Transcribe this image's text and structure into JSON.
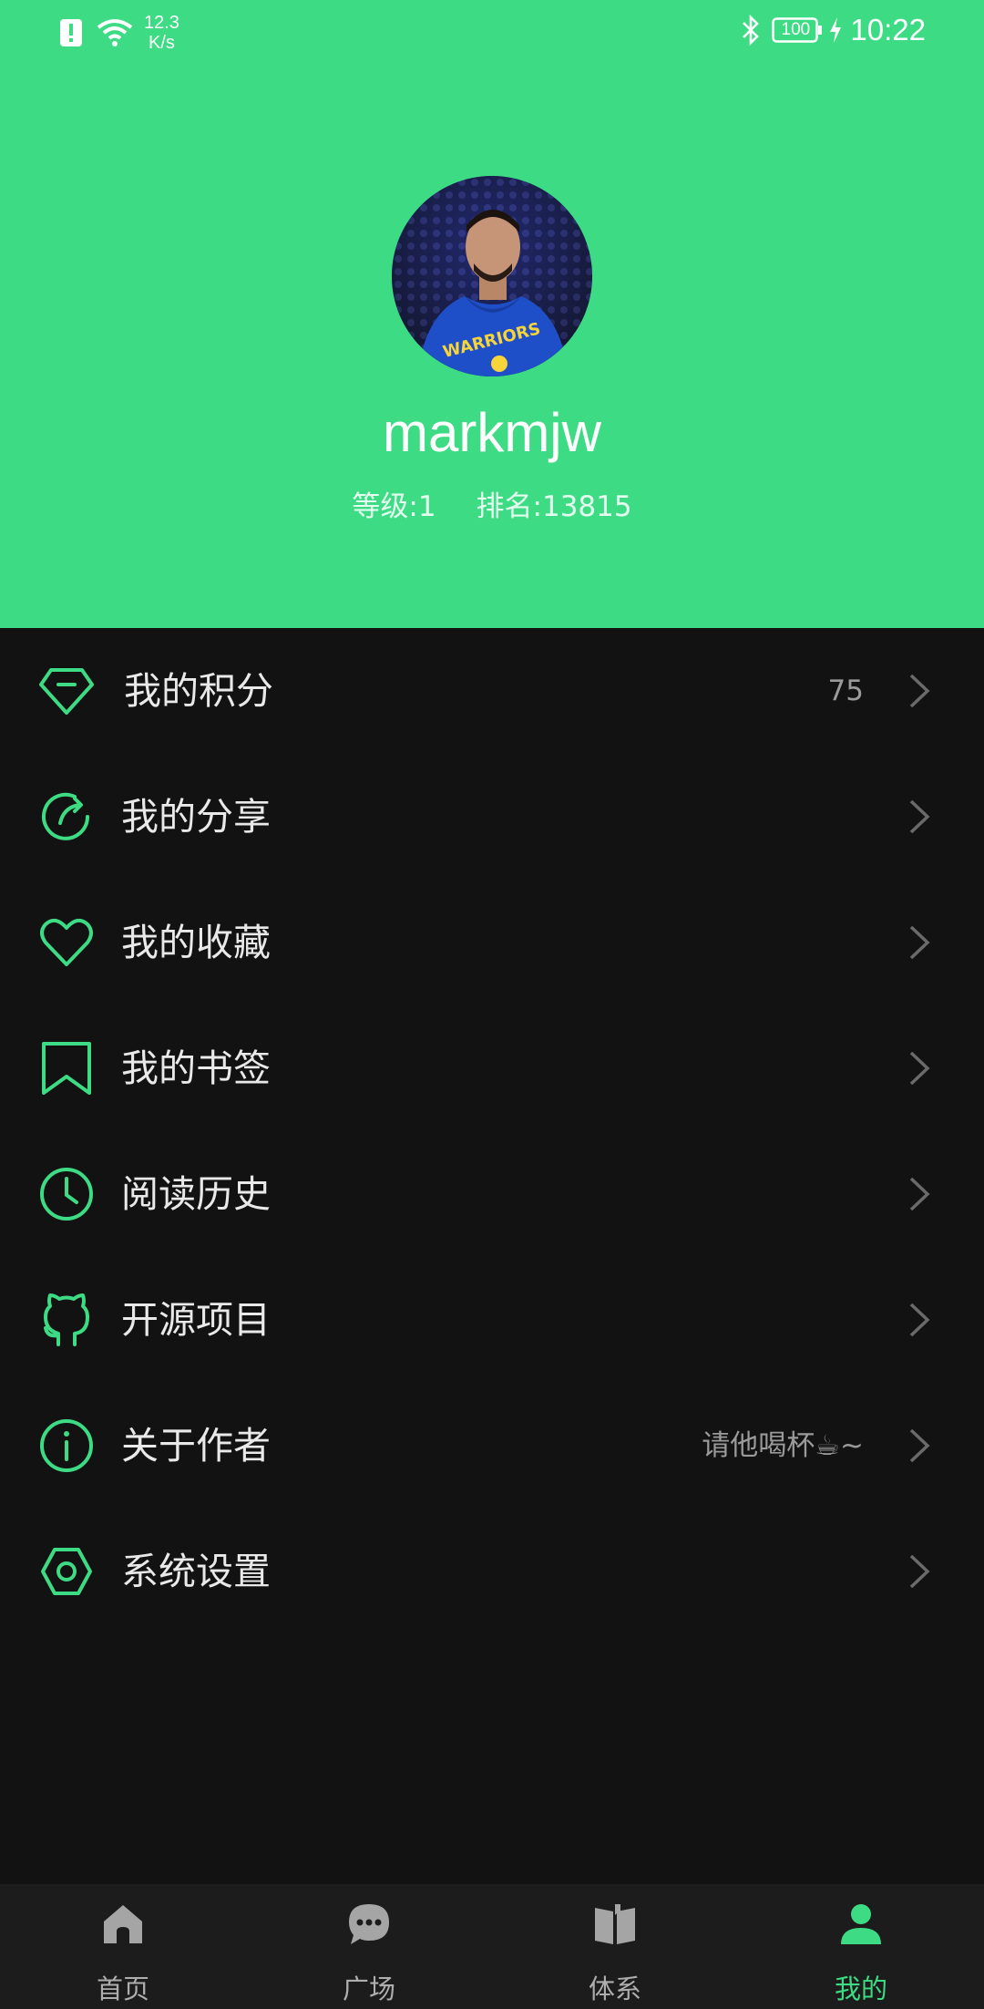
{
  "status_bar": {
    "net_speed_value": "12.3",
    "net_speed_unit": "K/s",
    "battery": "100",
    "time": "10:22"
  },
  "profile": {
    "username": "markmjw",
    "level": "等级:1",
    "rank": "排名:13815"
  },
  "menu": [
    {
      "label": "我的积分",
      "value": "75",
      "icon": "diamond-icon"
    },
    {
      "label": "我的分享",
      "value": "",
      "icon": "share-icon"
    },
    {
      "label": "我的收藏",
      "value": "",
      "icon": "heart-icon"
    },
    {
      "label": "我的书签",
      "value": "",
      "icon": "bookmark-icon"
    },
    {
      "label": "阅读历史",
      "value": "",
      "icon": "clock-icon"
    },
    {
      "label": "开源项目",
      "value": "",
      "icon": "github-icon"
    },
    {
      "label": "关于作者",
      "value": "请他喝杯☕~",
      "icon": "info-icon"
    },
    {
      "label": "系统设置",
      "value": "",
      "icon": "settings-icon"
    }
  ],
  "bottom_nav": [
    {
      "label": "首页",
      "icon": "home-icon",
      "active": false
    },
    {
      "label": "广场",
      "icon": "chat-icon",
      "active": false
    },
    {
      "label": "体系",
      "icon": "book-icon",
      "active": false
    },
    {
      "label": "我的",
      "icon": "person-icon",
      "active": true
    }
  ],
  "colors": {
    "accent": "#3ddc84",
    "background": "#121212",
    "nav_background": "#1c1c1c",
    "text_primary": "#e9e9e9",
    "text_secondary": "#9a9a9a"
  }
}
